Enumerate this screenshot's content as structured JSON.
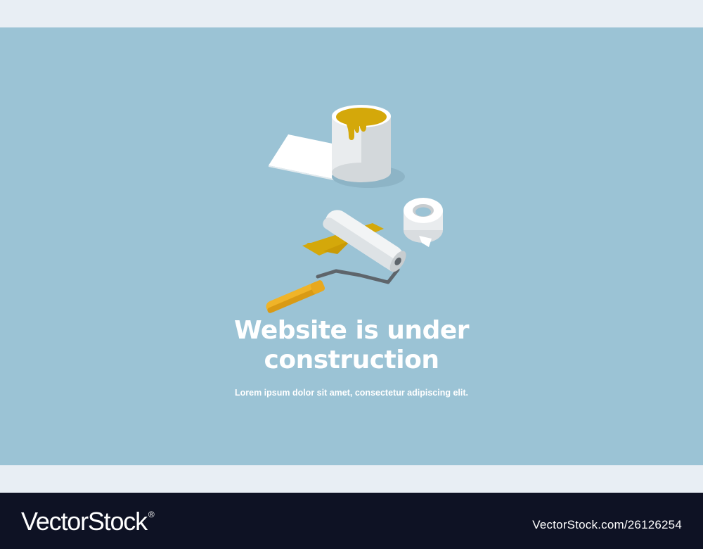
{
  "hero": {
    "title_line1": "Website is under",
    "title_line2": "construction",
    "subtitle": "Lorem ipsum dolor sit amet, consectetur adipiscing elit."
  },
  "footer": {
    "brand": "VectorStock",
    "trademark": "®",
    "image_id": "VectorStock.com/26126254"
  },
  "colors": {
    "background": "#9bc3d5",
    "band": "#e8eef4",
    "footer": "#0e1224",
    "paint": "#d4a80a",
    "roller_handle": "#f0b428"
  }
}
